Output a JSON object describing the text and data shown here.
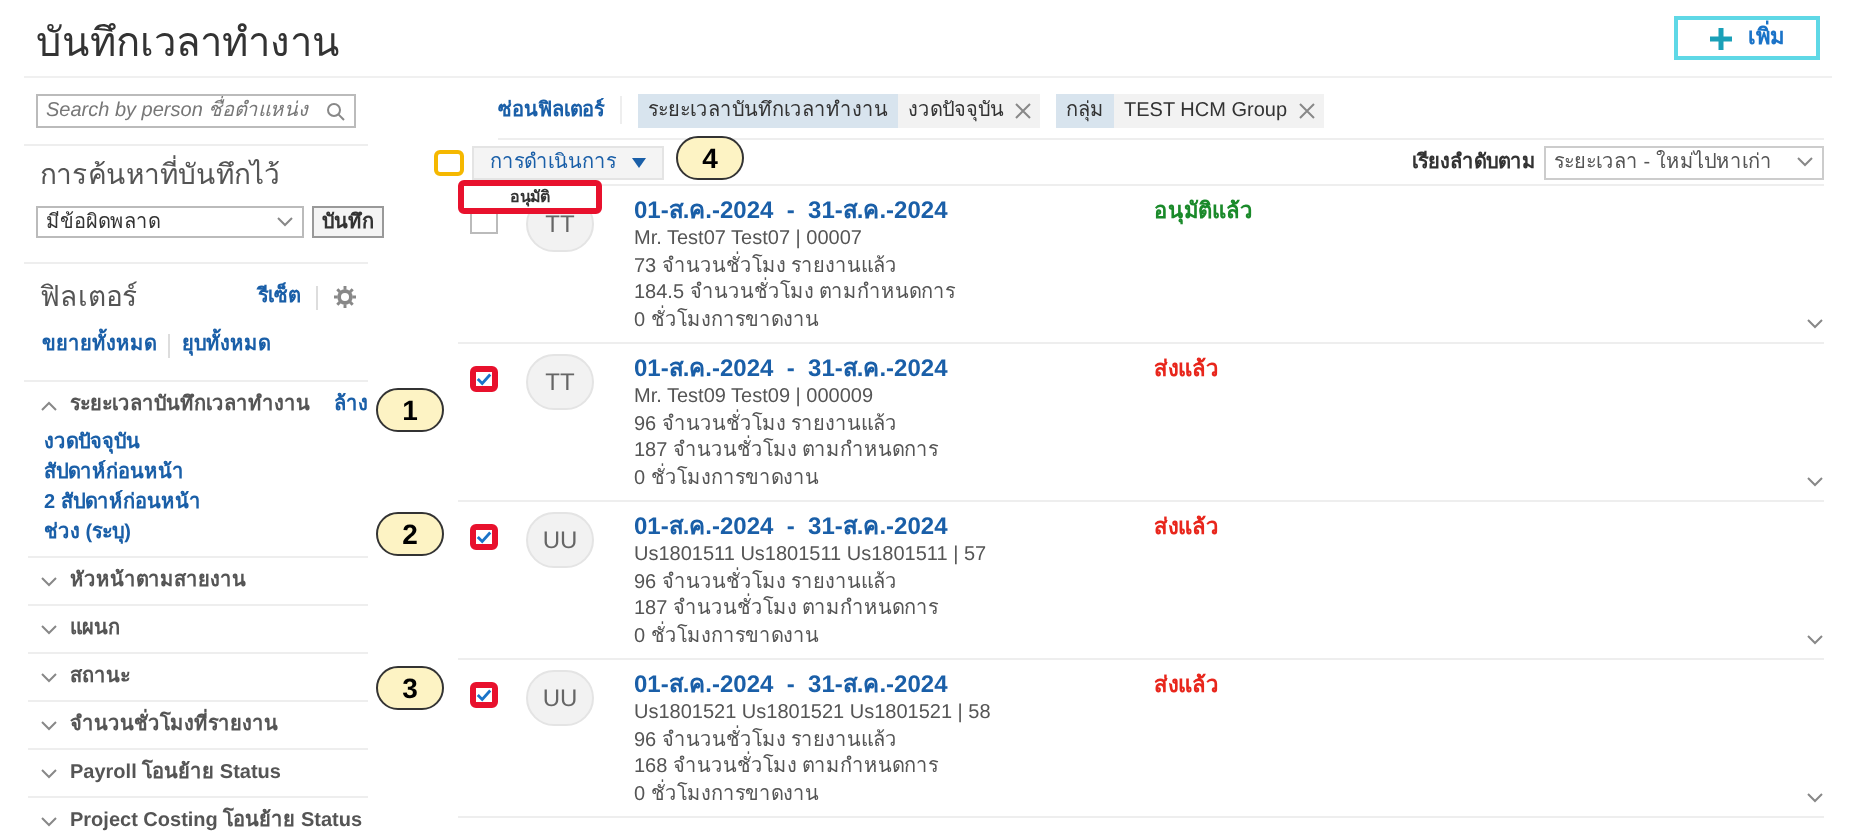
{
  "page": {
    "title": "บันทึกเวลาทำงาน",
    "add_button": "เพิ่ม"
  },
  "sidebar": {
    "search": {
      "placeholder": "Search by person ชื่อตำแหน่ง"
    },
    "saved_searches": {
      "title": "การค้นหาที่บันทึกไว้",
      "value": "มีข้อผิดพลาด",
      "save_button": "บันทึก"
    },
    "filters": {
      "title": "ฟิลเตอร์",
      "reset": "รีเซ็ต",
      "expand_all": "ขยายทั้งหมด",
      "collapse_all": "ยุบทั้งหมด",
      "sections": [
        {
          "label": "ระยะเวลาบันทึกเวลาทำงาน",
          "expanded": true,
          "clear": "ล้าง",
          "options": [
            "งวดปัจจุบัน",
            "สัปดาห์ก่อนหน้า",
            "2 สัปดาห์ก่อนหน้า",
            "ช่วง (ระบุ)"
          ]
        },
        {
          "label": "หัวหน้าตามสายงาน",
          "expanded": false
        },
        {
          "label": "แผนก",
          "expanded": false
        },
        {
          "label": "สถานะ",
          "expanded": false
        },
        {
          "label": "จำนวนชั่วโมงที่รายงาน",
          "expanded": false
        },
        {
          "label": "Payroll โอนย้าย Status",
          "expanded": false
        },
        {
          "label": "Project Costing โอนย้าย Status",
          "expanded": false
        }
      ]
    }
  },
  "filter_bar": {
    "hide_filters": "ซ่อนฟิลเตอร์",
    "chips": [
      {
        "name": "ระยะเวลาบันทึกเวลาทำงาน",
        "value": "งวดปัจจุบัน"
      },
      {
        "name": "กลุ่ม",
        "value": "TEST HCM Group"
      }
    ]
  },
  "toolbar": {
    "select_all_checked": false,
    "actions": "การดำเนินการ",
    "menu_item": "อนุมัติ",
    "sort_label": "เรียงลำดับตาม",
    "sort_value": "ระยะเวลา - ใหม่ไปหาเก่า"
  },
  "rows": [
    {
      "checked": false,
      "highlighted": false,
      "avatar": "TT",
      "period": "01-ส.ค.-2024  -  31-ส.ค.-2024",
      "person": "Mr. Test07 Test07 | 00007",
      "reported": "73 จำนวนชั่วโมง รายงานแล้ว",
      "scheduled": "184.5 จำนวนชั่วโมง ตามกำหนดการ",
      "absence": "0 ชั่วโมงการขาดงาน",
      "status": "อนุมัติแล้ว",
      "color": "#1a8a2a"
    },
    {
      "checked": true,
      "highlighted": true,
      "avatar": "TT",
      "period": "01-ส.ค.-2024  -  31-ส.ค.-2024",
      "person": "Mr. Test09 Test09 | 000009",
      "reported": "96 จำนวนชั่วโมง รายงานแล้ว",
      "scheduled": "187 จำนวนชั่วโมง ตามกำหนดการ",
      "absence": "0 ชั่วโมงการขาดงาน",
      "status": "ส่งแล้ว",
      "color": "#e8261c"
    },
    {
      "checked": true,
      "highlighted": true,
      "avatar": "UU",
      "period": "01-ส.ค.-2024  -  31-ส.ค.-2024",
      "person": "Us1801511 Us1801511 Us1801511 | 57",
      "reported": "96 จำนวนชั่วโมง รายงานแล้ว",
      "scheduled": "187 จำนวนชั่วโมง ตามกำหนดการ",
      "absence": "0 ชั่วโมงการขาดงาน",
      "status": "ส่งแล้ว",
      "color": "#e8261c"
    },
    {
      "checked": true,
      "highlighted": true,
      "avatar": "UU",
      "period": "01-ส.ค.-2024  -  31-ส.ค.-2024",
      "person": "Us1801521 Us1801521 Us1801521 | 58",
      "reported": "96 จำนวนชั่วโมง รายงานแล้ว",
      "scheduled": "168 จำนวนชั่วโมง ตามกำหนดการ",
      "absence": "0 ชั่วโมงการขาดงาน",
      "status": "ส่งแล้ว",
      "color": "#e8261c"
    }
  ],
  "callouts": [
    "1",
    "2",
    "3",
    "4"
  ]
}
